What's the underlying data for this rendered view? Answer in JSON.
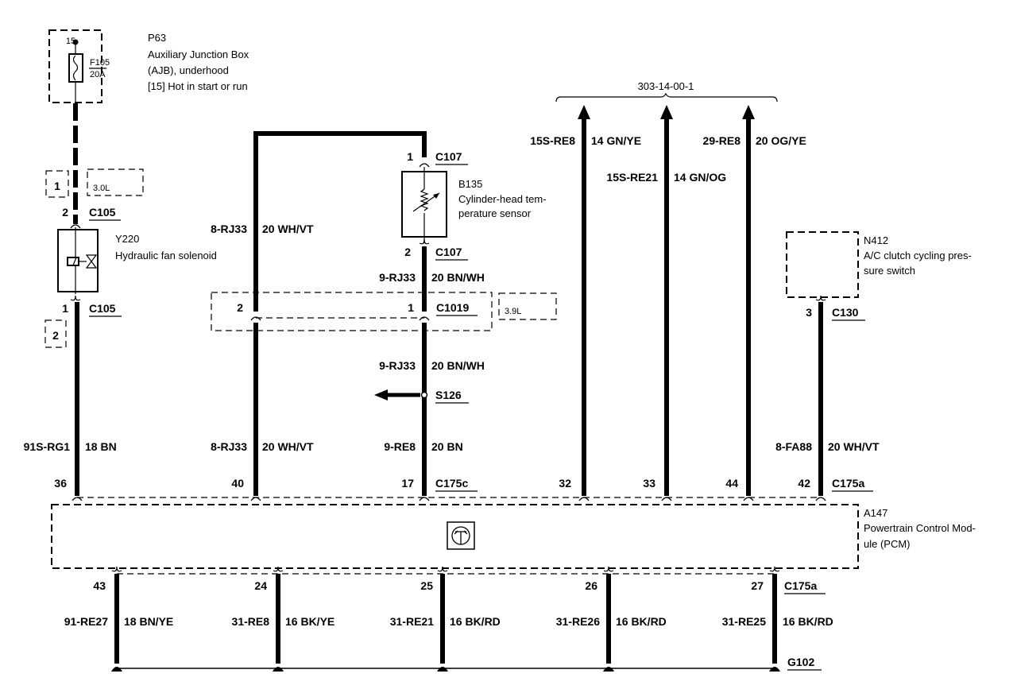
{
  "components": {
    "p63": {
      "id": "P63",
      "name_line1": "Auxiliary Junction Box",
      "name_line2": "(AJB), underhood",
      "name_line3": "[15] Hot in start or run",
      "pin": "15",
      "fuse_id": "F105",
      "fuse_rating": "20A"
    },
    "y220": {
      "id": "Y220",
      "name": "Hydraulic fan solenoid"
    },
    "b135": {
      "id": "B135",
      "name_line1": "Cylinder-head tem-",
      "name_line2": "perature sensor"
    },
    "n412": {
      "id": "N412",
      "name_line1": "A/C clutch cycling pres-",
      "name_line2": "sure switch"
    },
    "a147": {
      "id": "A147",
      "name_line1": "Powertrain Control Mod-",
      "name_line2": "ule (PCM)"
    }
  },
  "variant_boxes": {
    "left_1": "1",
    "left_2": "2",
    "engine_30": "3.0L",
    "engine_39": "3.9L"
  },
  "connectors": {
    "c105_top": {
      "name": "C105",
      "pin": "2"
    },
    "c105_bot": {
      "name": "C105",
      "pin": "1"
    },
    "c107_top": {
      "name": "C107",
      "pin": "1"
    },
    "c107_bot": {
      "name": "C107",
      "pin": "2"
    },
    "c1019": {
      "name": "C1019",
      "pin_left": "2",
      "pin_right": "1"
    },
    "s126": {
      "name": "S126"
    },
    "c130": {
      "name": "C130",
      "pin": "3"
    },
    "c175c": {
      "name": "C175c"
    },
    "c175a_top": {
      "name": "C175a"
    },
    "c175a_bot": {
      "name": "C175a"
    },
    "g102": {
      "name": "G102"
    }
  },
  "reference": "303-14-00-1",
  "top_wires": [
    {
      "circuit": "91S-RG1",
      "gauge_color": "18 BN",
      "pcm_pin": "36"
    },
    {
      "circuit": "8-RJ33",
      "gauge_color": "20 WH/VT",
      "pcm_pin": "40",
      "upper_circuit": "8-RJ33",
      "upper_gauge_color": "20 WH/VT"
    },
    {
      "circuit": "9-RE8",
      "gauge_color": "20 BN",
      "pcm_pin": "17",
      "upper_circuit": "9-RJ33",
      "upper_gauge_color": "20 BN/WH",
      "mid_circuit": "9-RJ33",
      "mid_gauge_color": "20 BN/WH"
    },
    {
      "circuit": "15S-RE8",
      "gauge_color": "14 GN/YE",
      "pcm_pin": "32"
    },
    {
      "circuit": "15S-RE21",
      "gauge_color": "14 GN/OG",
      "pcm_pin": "33"
    },
    {
      "circuit": "29-RE8",
      "gauge_color": "20 OG/YE",
      "pcm_pin": "44"
    },
    {
      "circuit": "8-FA88",
      "gauge_color": "20 WH/VT",
      "pcm_pin": "42"
    }
  ],
  "bottom_wires": [
    {
      "circuit": "91-RE27",
      "gauge_color": "18 BN/YE",
      "pcm_pin": "43"
    },
    {
      "circuit": "31-RE8",
      "gauge_color": "16 BK/YE",
      "pcm_pin": "24"
    },
    {
      "circuit": "31-RE21",
      "gauge_color": "16 BK/RD",
      "pcm_pin": "25"
    },
    {
      "circuit": "31-RE26",
      "gauge_color": "16 BK/RD",
      "pcm_pin": "26"
    },
    {
      "circuit": "31-RE25",
      "gauge_color": "16 BK/RD",
      "pcm_pin": "27"
    }
  ]
}
